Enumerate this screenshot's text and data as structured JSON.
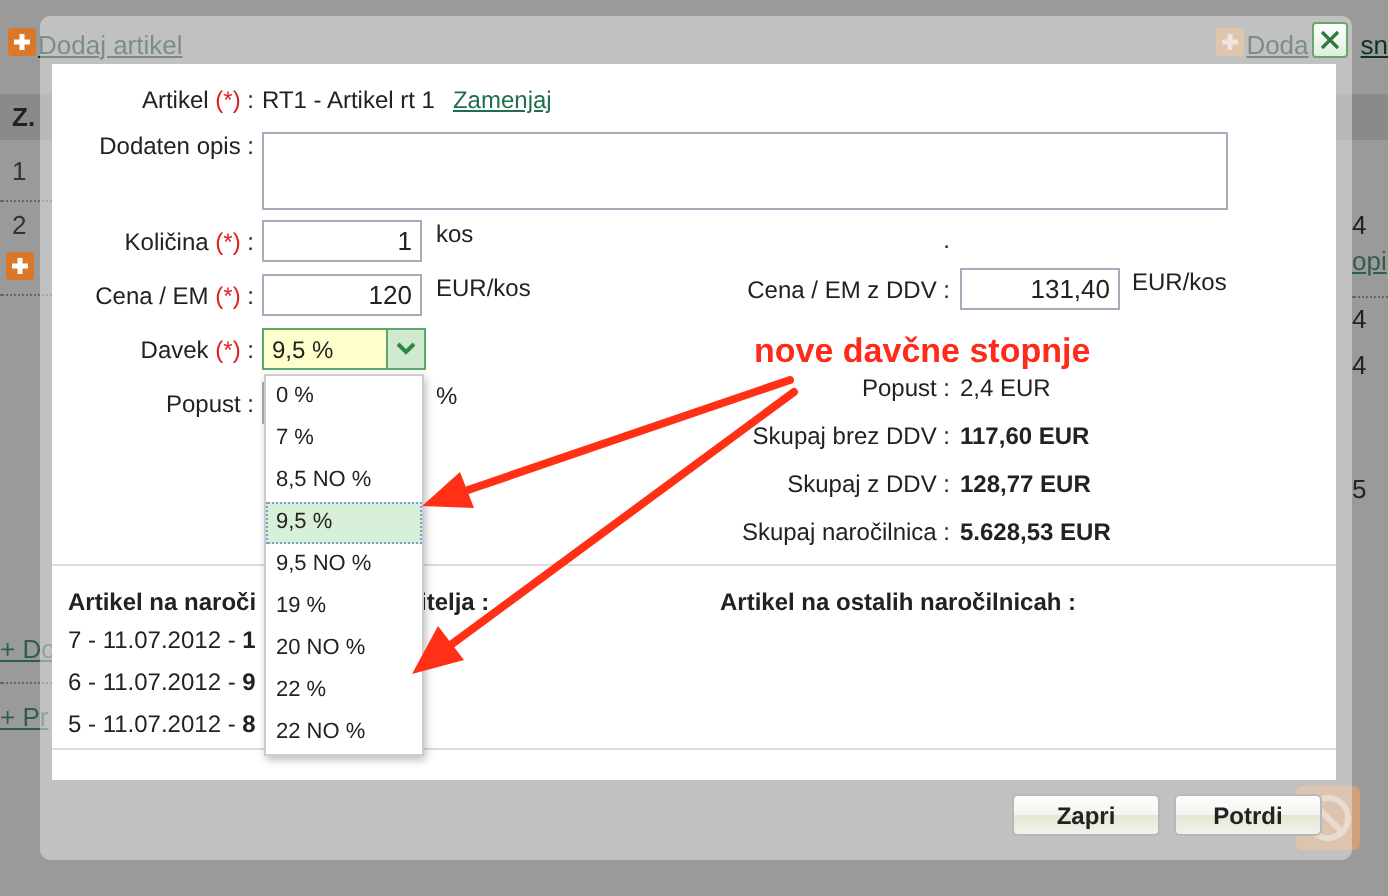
{
  "background": {
    "add_article_link": "Dodaj artikel",
    "right_link_parts": [
      "Doda",
      "sn"
    ],
    "table_header": "Z.",
    "row_numbers": [
      "1",
      "2"
    ],
    "bottom_links": [
      "+ Do",
      "+ Pr"
    ],
    "right_texts": [
      "4",
      "opi",
      "4",
      "4",
      "5"
    ]
  },
  "dialog": {
    "article": {
      "label": "Artikel",
      "mark": "(*)",
      "suffix": ":",
      "value": "RT1 - Artikel rt 1",
      "link": "Zamenjaj"
    },
    "description": {
      "label": "Dodaten opis :"
    },
    "left_fields": [
      {
        "kind": "input",
        "label": "Količina",
        "mark": "(*)",
        "suffix": ":",
        "value": "1",
        "unit": "kos"
      },
      {
        "kind": "input",
        "label": "Cena / EM",
        "mark": "(*)",
        "suffix": ":",
        "value": "120",
        "unit": "EUR/kos"
      },
      {
        "kind": "select",
        "label": "Davek",
        "mark": "(*)",
        "suffix": ":",
        "value": "9,5 %",
        "expanded": true,
        "options": [
          {
            "label": "0 %",
            "selected": false
          },
          {
            "label": "7 %",
            "selected": false
          },
          {
            "label": "8,5 NO %",
            "selected": false
          },
          {
            "label": "9,5 %",
            "selected": true
          },
          {
            "label": "9,5 NO %",
            "selected": false
          },
          {
            "label": "19 %",
            "selected": false
          },
          {
            "label": "20 NO %",
            "selected": false
          },
          {
            "label": "22 %",
            "selected": false
          },
          {
            "label": "22 NO %",
            "selected": false
          }
        ]
      },
      {
        "kind": "input",
        "label": "Popust :",
        "unit": "%"
      }
    ],
    "right_dot": ".",
    "right_input": {
      "label": "Cena / EM z DDV :",
      "value": "131,40",
      "unit": "EUR/kos"
    },
    "totals": [
      {
        "label": "Popust :",
        "value": "2,4 EUR",
        "bold": false
      },
      {
        "label": "Skupaj brez DDV :",
        "value": "117,60 EUR",
        "bold": true
      },
      {
        "label": "Skupaj z DDV :",
        "value": "128,77 EUR",
        "bold": true
      },
      {
        "label": "Skupaj naročilnica :",
        "value": "5.628,53 EUR",
        "bold": true
      }
    ],
    "history_heading_parts": [
      "Artikel na naroči",
      "itelja :"
    ],
    "history": [
      "7 - 11.07.2012 - **1**",
      "6 - 11.07.2012 - **9**",
      "5 - 11.07.2012 - **8**"
    ],
    "other_heading": "Artikel na ostalih naročilnicah :",
    "buttons": [
      {
        "label": "Zapri"
      },
      {
        "label": "Potrdi"
      }
    ]
  },
  "annotation": {
    "text": "nove davčne stopnje"
  }
}
